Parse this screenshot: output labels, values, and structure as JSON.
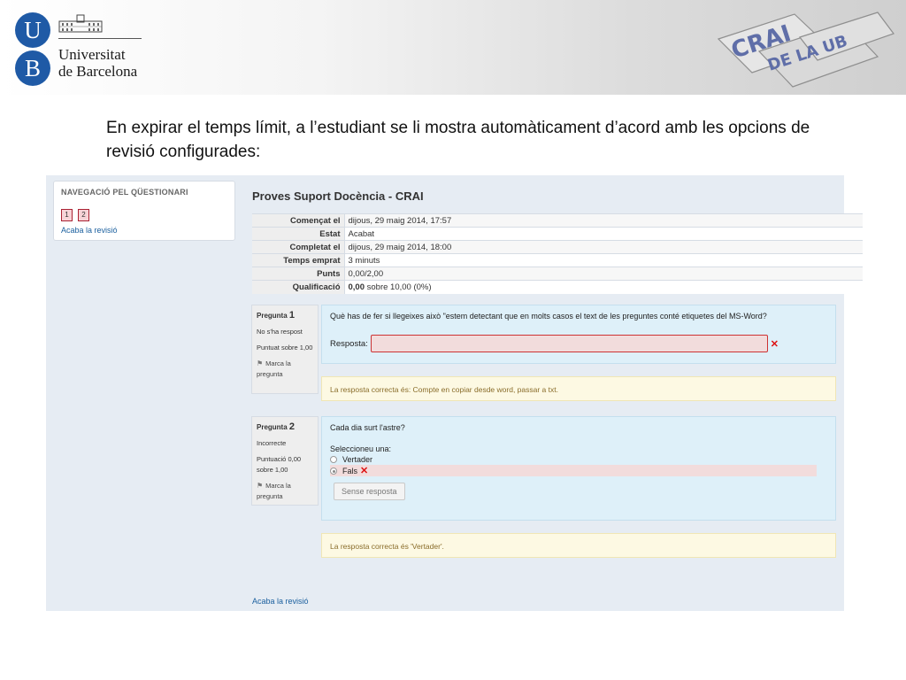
{
  "header": {
    "ub_letters": [
      "U",
      "B"
    ],
    "ub_name_lines": [
      "Universitat",
      "de Barcelona"
    ],
    "crai_logo_text": [
      "CRAI",
      "DE LA UB"
    ]
  },
  "intro": "En expirar el temps límit, a l’estudiant se li mostra automàticament d’acord amb les opcions de revisió configurades:",
  "nav": {
    "title": "NAVEGACIÓ PEL QÜESTIONARI",
    "buttons": [
      "1",
      "2"
    ],
    "finish_link": "Acaba la revisió"
  },
  "quiz": {
    "title": "Proves Suport Docència - CRAI",
    "summary": [
      {
        "label": "Començat el",
        "value": "dijous, 29 maig 2014, 17:57"
      },
      {
        "label": "Estat",
        "value": "Acabat"
      },
      {
        "label": "Completat el",
        "value": "dijous, 29 maig 2014, 18:00"
      },
      {
        "label": "Temps emprat",
        "value": "3 minuts"
      },
      {
        "label": "Punts",
        "value": "0,00/2,00"
      },
      {
        "label": "Qualificació",
        "value_bold": "0,00",
        "value_rest": " sobre 10,00 (0%)"
      }
    ]
  },
  "questions": [
    {
      "prefix": "Pregunta",
      "number": "1",
      "state": "No s'ha respost",
      "mark": "Puntuat sobre 1,00",
      "flag": "Marca la pregunta",
      "text": "Què has de fer si llegeixes això \"estem detectant que en molts casos el text de les preguntes conté etiquetes del MS-Word?",
      "answer_label": "Resposta:",
      "answer_value": "",
      "feedback": "La resposta correcta és: Compte en copiar desde word, passar a txt."
    },
    {
      "prefix": "Pregunta",
      "number": "2",
      "state": "Incorrecte",
      "mark": "Puntuació 0,00 sobre 1,00",
      "flag": "Marca la pregunta",
      "text": "Cada dia surt l'astre?",
      "prompt": "Seleccioneu una:",
      "options": [
        "Vertader",
        "Fals"
      ],
      "selected": "Fals",
      "check_button": "Sense resposta",
      "feedback": "La resposta correcta és 'Vertader'."
    }
  ],
  "footer_link": "Acaba la revisió",
  "colors": {
    "ub_blue": "#1f5aa6",
    "link": "#1a5f9e",
    "question_bg": "#def0f9",
    "feedback_bg": "#fdf9e3",
    "incorrect_bg": "#f2dcdc"
  }
}
